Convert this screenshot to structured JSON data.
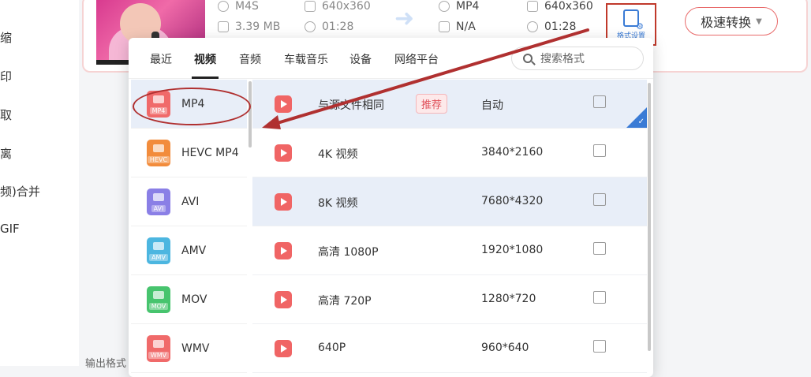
{
  "sidebar": {
    "items": [
      {
        "label": "缩"
      },
      {
        "label": "印"
      },
      {
        "label": "取"
      },
      {
        "label": "离"
      },
      {
        "label": "频)合并"
      },
      {
        "label": "GIF"
      }
    ]
  },
  "file": {
    "source": {
      "format": "M4S",
      "resolution": "640x360",
      "size": "3.39 MB",
      "duration": "01:28"
    },
    "target": {
      "format": "MP4",
      "resolution": "640x360",
      "size": "N/A",
      "duration": "01:28"
    }
  },
  "toolbar": {
    "format_settings_label": "格式设置",
    "fast_convert_label": "极速转换"
  },
  "popup": {
    "tabs": [
      {
        "label": "最近"
      },
      {
        "label": "视频"
      },
      {
        "label": "音频"
      },
      {
        "label": "车载音乐"
      },
      {
        "label": "设备"
      },
      {
        "label": "网络平台"
      }
    ],
    "search_placeholder": "搜索格式",
    "formats": [
      {
        "name": "MP4",
        "badge": "MP4",
        "color": "#f06a6a"
      },
      {
        "name": "HEVC MP4",
        "badge": "HEVC",
        "color": "#f28c3c"
      },
      {
        "name": "AVI",
        "badge": "AVI",
        "color": "#8a7fe6"
      },
      {
        "name": "AMV",
        "badge": "AMV",
        "color": "#4cb6e0"
      },
      {
        "name": "MOV",
        "badge": "MOV",
        "color": "#47c46e"
      },
      {
        "name": "WMV",
        "badge": "WMV",
        "color": "#f06a6a"
      }
    ],
    "qualities": [
      {
        "name": "与源文件相同",
        "tag": "推荐",
        "resolution": "自动"
      },
      {
        "name": "4K 视频",
        "resolution": "3840*2160"
      },
      {
        "name": "8K 视频",
        "resolution": "7680*4320"
      },
      {
        "name": "高清 1080P",
        "resolution": "1920*1080"
      },
      {
        "name": "高清 720P",
        "resolution": "1280*720"
      },
      {
        "name": "640P",
        "resolution": "960*640"
      }
    ]
  },
  "footer": {
    "output_label": "输出格式"
  },
  "colors": {
    "accent": "#3a7bd5",
    "annotation": "#b03030",
    "brand": "#f06565"
  }
}
